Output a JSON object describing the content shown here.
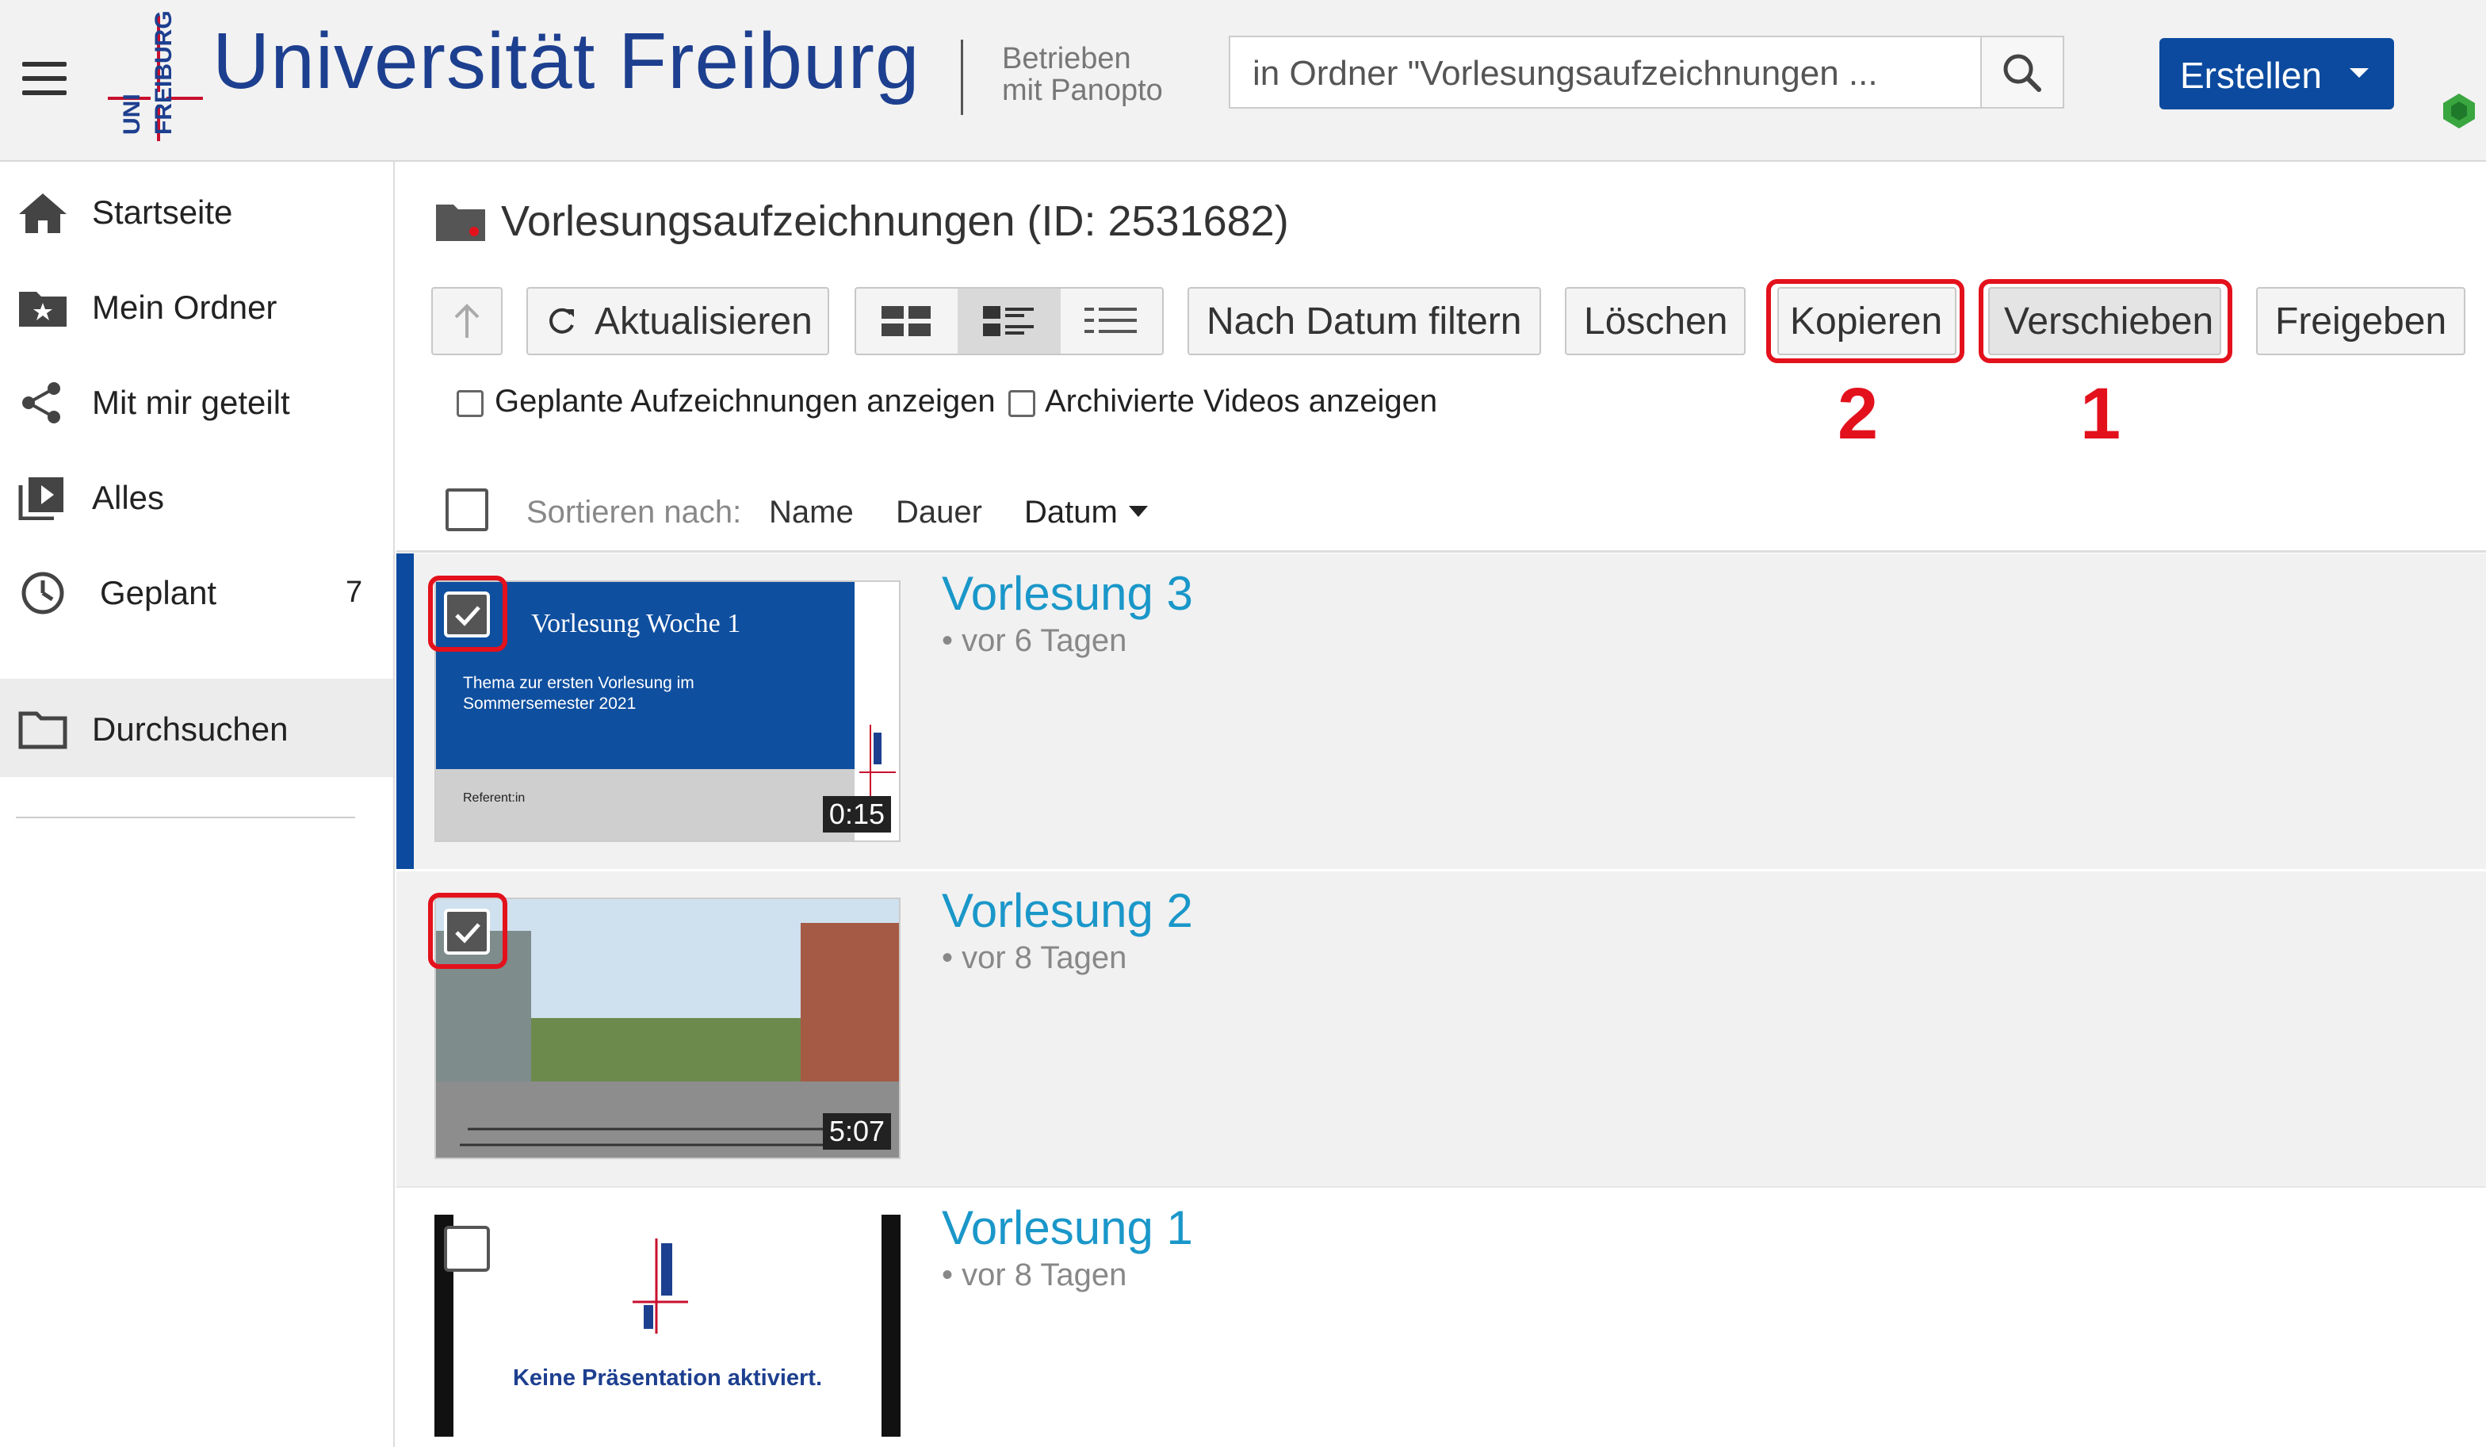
{
  "header": {
    "brand_small_top": "UNI",
    "brand_small_bottom": "FREIBURG",
    "title": "Universität Freiburg",
    "powered_line1": "Betrieben",
    "powered_line2": "mit Panopto",
    "search_value": "in Ordner \"Vorlesungsaufzeichnungen ...",
    "create_label": "Erstellen"
  },
  "sidebar": {
    "items": [
      {
        "label": "Startseite",
        "icon": "home-icon"
      },
      {
        "label": "Mein Ordner",
        "icon": "folder-star-icon"
      },
      {
        "label": "Mit mir geteilt",
        "icon": "share-icon"
      },
      {
        "label": "Alles",
        "icon": "video-library-icon"
      },
      {
        "label": "Geplant",
        "icon": "clock-icon",
        "count": "7"
      },
      {
        "label": "Durchsuchen",
        "icon": "folder-icon",
        "active": true
      }
    ]
  },
  "main": {
    "folder_title": "Vorlesungsaufzeichnungen (ID: 2531682)",
    "toolbar": {
      "refresh": "Aktualisieren",
      "filter_date": "Nach Datum filtern",
      "delete": "Löschen",
      "copy": "Kopieren",
      "move": "Verschieben",
      "share": "Freigeben"
    },
    "annotations": {
      "copy_number": "2",
      "move_number": "1"
    },
    "options": {
      "scheduled": "Geplante Aufzeichnungen anzeigen",
      "archived": "Archivierte Videos anzeigen"
    },
    "sort": {
      "label": "Sortieren nach:",
      "name": "Name",
      "duration": "Dauer",
      "date": "Datum"
    },
    "videos": [
      {
        "title": "Vorlesung 3",
        "age": "• vor 6 Tagen",
        "duration": "0:15",
        "selected": true,
        "thumb_heading": "Vorlesung Woche 1",
        "thumb_sub1": "Thema zur ersten Vorlesung im",
        "thumb_sub2": "Sommersemester 2021",
        "thumb_footer": "Referent:in"
      },
      {
        "title": "Vorlesung 2",
        "age": "• vor 8 Tagen",
        "duration": "5:07",
        "selected": true
      },
      {
        "title": "Vorlesung 1",
        "age": "• vor 8 Tagen",
        "selected": false,
        "thumb_text": "Keine Präsentation aktiviert."
      }
    ]
  },
  "colors": {
    "brand_blue": "#1d3f8f",
    "button_blue": "#0b4a9e",
    "link_blue": "#1a97c9",
    "highlight_red": "#e3111c"
  }
}
